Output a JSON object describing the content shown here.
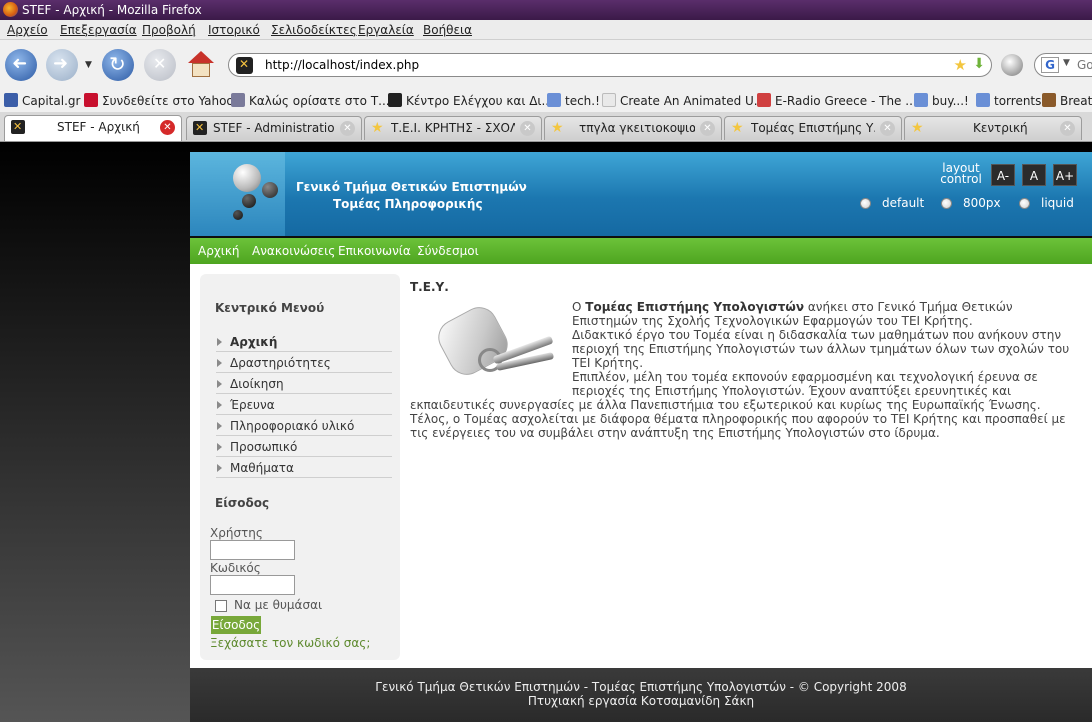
{
  "browser": {
    "window_title": "STEF - Αρχική - Mozilla Firefox",
    "menu": [
      "Αρχείο",
      "Επεξεργασία",
      "Προβολή",
      "Ιστορικό",
      "Σελιδοδείκτες",
      "Εργαλεία",
      "Βοήθεια"
    ],
    "url": "http://localhost/index.php",
    "search_placeholder": "Go",
    "bookmarks": [
      "Capital.gr",
      "Συνδεθείτε στο Yahoo!",
      "Καλώς ορίσατε στο Τ...",
      "Κέντρο Ελέγχου και Δι...",
      "tech.!",
      "Create An Animated U...",
      "E-Radio Greece - The ...",
      "buy...!",
      "torrents",
      "Breath"
    ],
    "tabs": [
      "STEF - Αρχική",
      "STEF - Administration...",
      "Τ.Ε.Ι. ΚΡΗΤΗΣ - ΣΧΟΛ...",
      "τπγλα γκειτιοκοψιας",
      "Τομέας Επιστήμης Υ...",
      "Κεντρική"
    ]
  },
  "site": {
    "title_line1": "Γενικό Τμήμα Θετικών Επιστημών",
    "title_line2": "Τομέας Πληροφορικής",
    "layout_control_label": "layout control",
    "font_buttons": [
      "A-",
      "A",
      "A+"
    ],
    "layout_options": [
      "default",
      "800px",
      "liquid"
    ],
    "nav": [
      "Αρχική",
      "Ανακοινώσεις",
      "Επικοινωνία",
      "Σύνδεσμοι"
    ],
    "sidebar": {
      "menu_heading": "Κεντρικό Μενού",
      "menu_items": [
        "Αρχική",
        "Δραστηριότητες",
        "Διοίκηση",
        "Έρευνα",
        "Πληροφοριακό υλικό",
        "Προσωπικό",
        "Μαθήματα"
      ],
      "login_heading": "Είσοδος",
      "username_label": "Χρήστης",
      "password_label": "Κωδικός",
      "remember_label": "Να με θυμάσαι",
      "login_button": "Είσοδος",
      "forgot_link": "Ξεχάσατε τον κωδικό σας;"
    },
    "article": {
      "title": "Τ.Ε.Υ.",
      "p1_pre": "Ο ",
      "p1_bold": "Τομέας Επιστήμης Υπολογιστών",
      "p1_post": " ανήκει στο Γενικό Τμήμα Θετικών Επιστημών της Σχολής Τεχνολογικών Εφαρμογών του ΤΕΙ Κρήτης.",
      "p2": "Διδακτικό έργο του Τομέα είναι η διδασκαλία των μαθημάτων που ανήκουν στην περιοχή της Επιστήμης Υπολογιστών των άλλων τμημάτων όλων των σχολών του ΤΕΙ Κρήτης.",
      "p3": "Επιπλέον, μέλη του τομέα εκπονούν εφαρμοσμένη και τεχνολογική έρευνα σε περιοχές της Επιστήμης Υπολογιστών. Έχουν αναπτύξει ερευνητικές και εκπαιδευτικές συνεργασίες με άλλα Πανεπιστήμια του εξωτερικού και κυρίως της Ευρωπαϊκής Ένωσης.",
      "p4": "Τέλος, ο Τομέας ασχολείται με διάφορα θέματα πληροφορικής που αφορούν το ΤΕΙ Κρήτης και προσπαθεί με τις ενέργειες του να συμβάλει στην ανάπτυξη της Επιστήμης Υπολογιστών στο ίδρυμα."
    },
    "footer_line1": "Γενικό Τμήμα Θετικών Επιστημών - Τομέας Επιστήμης Υπολογιστών - © Copyright 2008",
    "footer_line2": "Πτυχιακή εργασία Κοτσαμανίδη Σάκη"
  },
  "colors": {
    "header_blue": "#1c77b0",
    "nav_green": "#5cb32c",
    "login_button": "#78a83a",
    "footer_dark": "#2f2f2f"
  }
}
